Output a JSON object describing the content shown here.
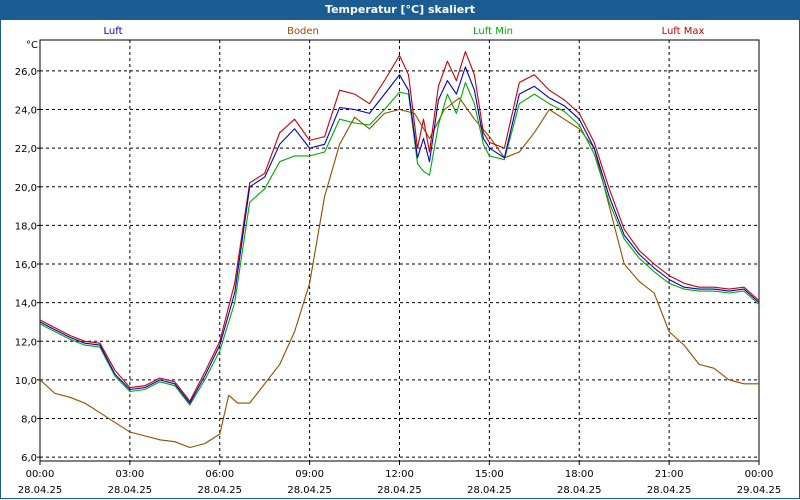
{
  "window": {
    "title": "Temperatur [°C] skaliert"
  },
  "chart_data": {
    "type": "line",
    "title": "Temperatur [°C] skaliert",
    "ylabel": "°C",
    "xlabel": "",
    "ylim": [
      5.8,
      27.6
    ],
    "xlim": [
      0,
      24
    ],
    "grid": true,
    "legend_position": "top",
    "y_ticks": [
      "6,0",
      "8,0",
      "10,0",
      "12,0",
      "14,0",
      "16,0",
      "18,0",
      "20,0",
      "22,0",
      "24,0",
      "26,0"
    ],
    "y_tick_values": [
      6,
      8,
      10,
      12,
      14,
      16,
      18,
      20,
      22,
      24,
      26
    ],
    "x_ticks": [
      {
        "time": "00:00",
        "date": "28.04.25"
      },
      {
        "time": "03:00",
        "date": "28.04.25"
      },
      {
        "time": "06:00",
        "date": "28.04.25"
      },
      {
        "time": "09:00",
        "date": "28.04.25"
      },
      {
        "time": "12:00",
        "date": "28.04.25"
      },
      {
        "time": "15:00",
        "date": "28.04.25"
      },
      {
        "time": "18:00",
        "date": "28.04.25"
      },
      {
        "time": "21:00",
        "date": "28.04.25"
      },
      {
        "time": "00:00",
        "date": "29.04.25"
      }
    ],
    "x_tick_hours": [
      0,
      3,
      6,
      9,
      12,
      15,
      18,
      21,
      24
    ],
    "series": [
      {
        "name": "Luft",
        "color": "#0000c8",
        "x": [
          0,
          0.5,
          1,
          1.5,
          2,
          2.5,
          3,
          3.5,
          4,
          4.5,
          5,
          5.5,
          6,
          6.5,
          7,
          7.5,
          8,
          8.5,
          9,
          9.5,
          10,
          10.5,
          11,
          11.5,
          12,
          12.3,
          12.6,
          12.8,
          13,
          13.3,
          13.6,
          13.9,
          14.2,
          14.5,
          14.8,
          15,
          15.5,
          16,
          16.5,
          17,
          17.5,
          18,
          18.5,
          19,
          19.5,
          20,
          20.5,
          21,
          21.5,
          22,
          22.5,
          23,
          23.5,
          24
        ],
        "y": [
          13,
          12.6,
          12.2,
          11.9,
          11.8,
          10.3,
          9.5,
          9.6,
          10,
          9.8,
          8.8,
          10.2,
          11.8,
          14.5,
          20,
          20.5,
          22.2,
          23,
          22,
          22.2,
          24.1,
          24,
          23.8,
          24.8,
          25.8,
          25,
          21.5,
          22.5,
          21.3,
          24.5,
          25.5,
          24.8,
          26.2,
          25,
          22.5,
          22,
          21.5,
          24.8,
          25.2,
          24.6,
          24.2,
          23.5,
          22,
          19.5,
          17.5,
          16.5,
          15.8,
          15.2,
          14.8,
          14.7,
          14.7,
          14.6,
          14.7,
          14
        ]
      },
      {
        "name": "Boden",
        "color": "#964b00",
        "x": [
          0,
          0.5,
          1,
          1.5,
          2,
          2.5,
          3,
          3.5,
          4,
          4.5,
          5,
          5.5,
          6,
          6.3,
          6.6,
          7,
          7.5,
          8,
          8.5,
          9,
          9.5,
          10,
          10.5,
          11,
          11.5,
          12,
          12.5,
          13,
          13.5,
          14,
          14.5,
          15,
          15.5,
          16,
          16.5,
          17,
          17.5,
          18,
          18.5,
          19,
          19.5,
          20,
          20.5,
          21,
          21.5,
          22,
          22.5,
          23,
          23.5,
          24
        ],
        "y": [
          10,
          9.3,
          9.1,
          8.8,
          8.3,
          7.8,
          7.3,
          7.1,
          6.9,
          6.8,
          6.5,
          6.7,
          7.2,
          9.2,
          8.8,
          8.8,
          9.8,
          10.8,
          12.5,
          15,
          19.5,
          22.2,
          23.6,
          23,
          23.8,
          24,
          23.8,
          22.5,
          24,
          24.6,
          23.5,
          22.6,
          21.5,
          21.8,
          22.8,
          24,
          23.5,
          23,
          22,
          19,
          16,
          15.1,
          14.5,
          12.5,
          11.8,
          10.8,
          10.6,
          10,
          9.8,
          9.8
        ]
      },
      {
        "name": "Luft Min",
        "color": "#00aa00",
        "x": [
          0,
          0.5,
          1,
          1.5,
          2,
          2.5,
          3,
          3.5,
          4,
          4.5,
          5,
          5.5,
          6,
          6.5,
          7,
          7.5,
          8,
          8.5,
          9,
          9.5,
          10,
          10.5,
          11,
          11.5,
          12,
          12.3,
          12.6,
          12.8,
          13,
          13.3,
          13.6,
          13.9,
          14.2,
          14.5,
          14.8,
          15,
          15.5,
          16,
          16.5,
          17,
          17.5,
          18,
          18.5,
          19,
          19.5,
          20,
          20.5,
          21,
          21.5,
          22,
          22.5,
          23,
          23.5,
          24
        ],
        "y": [
          12.9,
          12.5,
          12.1,
          11.8,
          11.7,
          10.2,
          9.4,
          9.5,
          9.9,
          9.7,
          8.7,
          10,
          11.5,
          14,
          19.2,
          19.9,
          21.3,
          21.6,
          21.6,
          21.8,
          23.5,
          23.3,
          23.2,
          24,
          24.9,
          24.8,
          21.2,
          20.8,
          20.6,
          23.2,
          24.8,
          23.8,
          25.4,
          24.3,
          22.2,
          21.6,
          21.4,
          24.3,
          24.8,
          24.3,
          23.9,
          23.2,
          21.7,
          19.2,
          17.3,
          16.3,
          15.6,
          15,
          14.7,
          14.6,
          14.6,
          14.5,
          14.6,
          13.9
        ]
      },
      {
        "name": "Luft Max",
        "color": "#c80000",
        "x": [
          0,
          0.5,
          1,
          1.5,
          2,
          2.5,
          3,
          3.5,
          4,
          4.5,
          5,
          5.5,
          6,
          6.5,
          7,
          7.5,
          8,
          8.5,
          9,
          9.5,
          10,
          10.5,
          11,
          11.5,
          12,
          12.3,
          12.6,
          12.8,
          13,
          13.3,
          13.6,
          13.9,
          14.2,
          14.5,
          14.8,
          15,
          15.5,
          16,
          16.5,
          17,
          17.5,
          18,
          18.5,
          19,
          19.5,
          20,
          20.5,
          21,
          21.5,
          22,
          22.5,
          23,
          23.5,
          24
        ],
        "y": [
          13.1,
          12.7,
          12.3,
          12,
          11.9,
          10.5,
          9.6,
          9.7,
          10.1,
          9.9,
          8.9,
          10.4,
          12,
          15,
          20.2,
          20.7,
          22.8,
          23.5,
          22.4,
          22.6,
          25,
          24.8,
          24.3,
          25.5,
          26.8,
          25.8,
          22,
          23.5,
          21.8,
          25.2,
          26.5,
          25.5,
          27,
          25.8,
          22.8,
          22.3,
          22,
          25.4,
          25.8,
          25,
          24.5,
          23.8,
          22.3,
          19.9,
          17.8,
          16.7,
          16,
          15.4,
          15,
          14.8,
          14.8,
          14.7,
          14.8,
          14.1
        ]
      }
    ]
  }
}
